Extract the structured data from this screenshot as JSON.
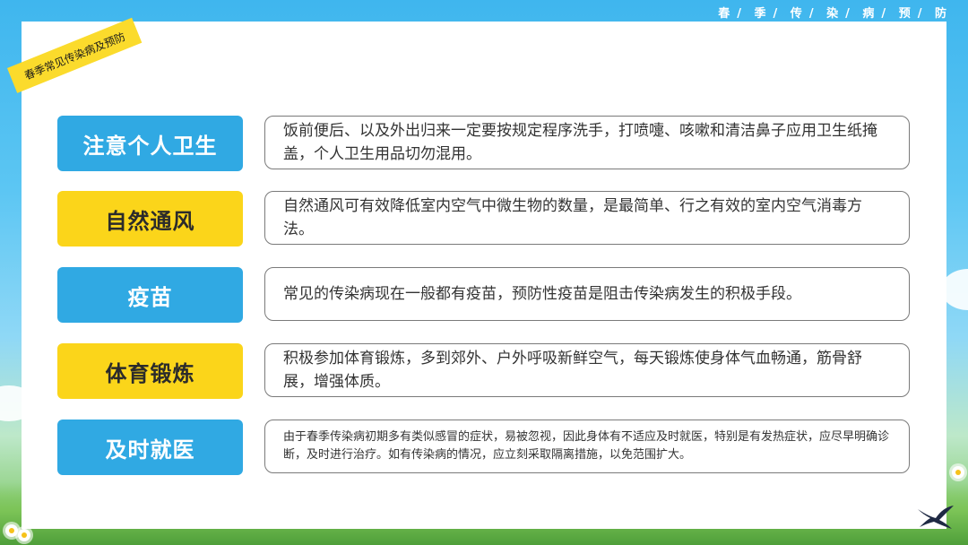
{
  "header": {
    "chars": [
      "春",
      "季",
      "传",
      "染",
      "病",
      "预",
      "防"
    ]
  },
  "ribbon": {
    "text": "春季常见传染病及预防"
  },
  "rows": [
    {
      "label": "注意个人卫生",
      "color": "blue",
      "text": "饭前便后、以及外出归来一定要按规定程序洗手，打喷嚏、咳嗽和清洁鼻子应用卫生纸掩盖，个人卫生用品切勿混用。"
    },
    {
      "label": "自然通风",
      "color": "yellow",
      "text": "自然通风可有效降低室内空气中微生物的数量，是最简单、行之有效的室内空气消毒方法。"
    },
    {
      "label": "疫苗",
      "color": "blue",
      "text": "常见的传染病现在一般都有疫苗，预防性疫苗是阻击传染病发生的积极手段。"
    },
    {
      "label": "体育锻炼",
      "color": "yellow",
      "text": "积极参加体育锻炼，多到郊外、户外呼吸新鲜空气，每天锻炼使身体气血畅通，筋骨舒展，增强体质。"
    },
    {
      "label": "及时就医",
      "color": "blue",
      "text": "由于春季传染病初期多有类似感冒的症状，易被忽视，因此身体有不适应及时就医，特别是有发热症状，应尽早明确诊断，及时进行治疗。如有传染病的情况，应立刻采取隔离措施，以免范围扩大。"
    }
  ],
  "colors": {
    "blue": "#30a9e3",
    "yellow": "#fbd51a"
  }
}
